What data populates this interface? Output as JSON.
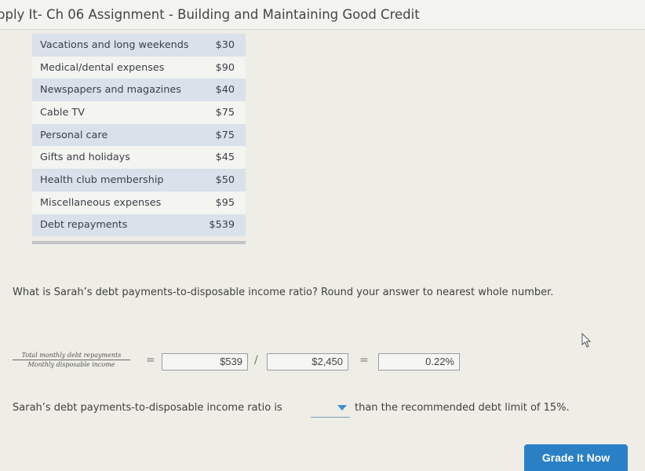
{
  "header": {
    "title": "pply It- Ch 06 Assignment - Building and Maintaining Good Credit"
  },
  "expenses": [
    {
      "label": "Vacations and long weekends",
      "amount": "$30"
    },
    {
      "label": "Medical/dental expenses",
      "amount": "$90"
    },
    {
      "label": "Newspapers and magazines",
      "amount": "$40"
    },
    {
      "label": "Cable TV",
      "amount": "$75"
    },
    {
      "label": "Personal care",
      "amount": "$75"
    },
    {
      "label": "Gifts and holidays",
      "amount": "$45"
    },
    {
      "label": "Health club membership",
      "amount": "$50"
    },
    {
      "label": "Miscellaneous expenses",
      "amount": "$95"
    },
    {
      "label": "Debt repayments",
      "amount": "$539"
    }
  ],
  "question": "What is Sarah’s debt payments-to-disposable income ratio? Round your answer to nearest whole number.",
  "formula": {
    "numerator_label": "Total monthly debt repayments",
    "denominator_label": "Monthly disposable income",
    "equals": "=",
    "divide": "/",
    "debt_value": "$539",
    "income_value": "$2,450",
    "result_value": "0.22%"
  },
  "comparison": {
    "prefix": "Sarah’s debt payments-to-disposable income ratio is",
    "selected": "",
    "suffix": "than the recommended debt limit of 15%."
  },
  "grade_button": "Grade It Now"
}
